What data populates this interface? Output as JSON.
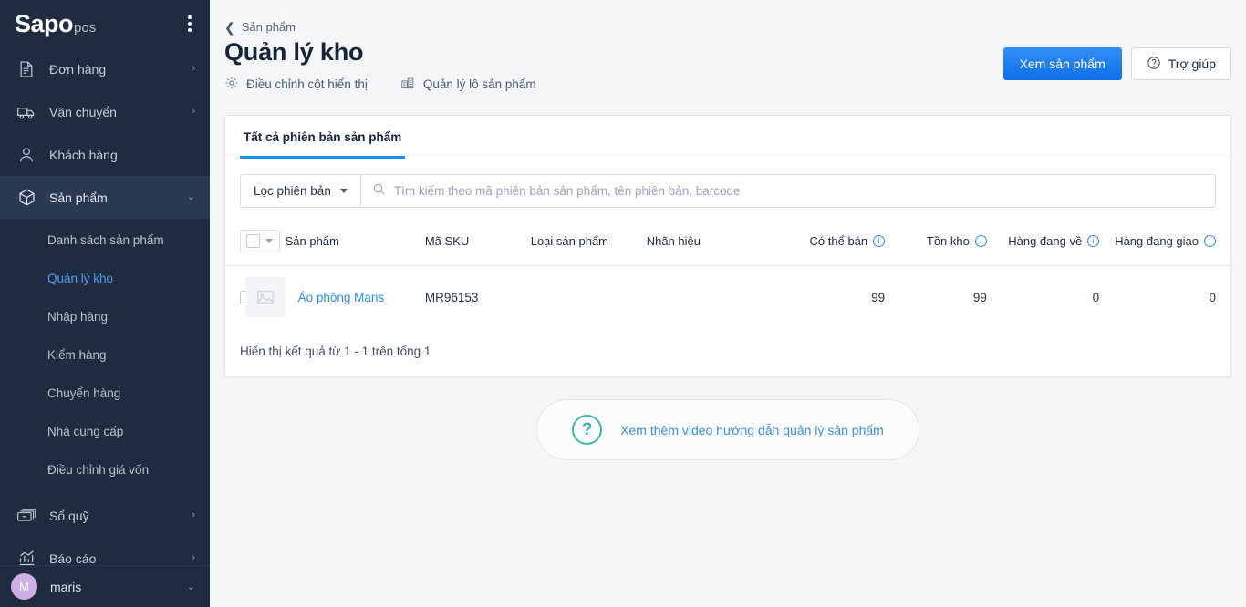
{
  "sidebar": {
    "logo": {
      "main": "Sapo",
      "sub": "pos"
    },
    "kebab_icon": "vertical-dots-icon",
    "items": [
      {
        "label": "Đơn hàng",
        "icon": "invoice-icon",
        "chevron": "›",
        "active": false
      },
      {
        "label": "Vận chuyển",
        "icon": "truck-icon",
        "chevron": "›",
        "active": false
      },
      {
        "label": "Khách hàng",
        "icon": "user-icon",
        "chevron": "",
        "active": false
      },
      {
        "label": "Sản phẩm",
        "icon": "box-icon",
        "chevron": "⌄",
        "active": true
      },
      {
        "label": "Sổ quỹ",
        "icon": "cash-icon",
        "chevron": "›",
        "active": false
      },
      {
        "label": "Báo cáo",
        "icon": "chart-icon",
        "chevron": "›",
        "active": false
      }
    ],
    "sub_items": [
      {
        "label": "Danh sách sản phẩm",
        "active": false
      },
      {
        "label": "Quản lý kho",
        "active": true
      },
      {
        "label": "Nhập hàng",
        "active": false
      },
      {
        "label": "Kiểm hàng",
        "active": false
      },
      {
        "label": "Chuyển hàng",
        "active": false
      },
      {
        "label": "Nhà cung cấp",
        "active": false
      },
      {
        "label": "Điều chỉnh giá vốn",
        "active": false
      }
    ],
    "user": {
      "initial": "M",
      "name": "maris",
      "chevron": "⌄"
    }
  },
  "header": {
    "breadcrumb": "Sản phẩm",
    "breadcrumb_icon": "chevron-left-icon",
    "title": "Quản lý kho",
    "primary_button": "Xem sản phẩm",
    "help_button": "Trợ giúp",
    "help_icon": "question-circle-icon",
    "quick_links": [
      {
        "label": "Điều chỉnh cột hiển thị",
        "icon": "gear-icon"
      },
      {
        "label": "Quản lý lô sản phẩm",
        "icon": "warehouse-icon"
      }
    ]
  },
  "card": {
    "tabs": [
      {
        "label": "Tất cả phiên bản sản phẩm",
        "active": true
      }
    ],
    "filter_button": "Lọc phiên bản",
    "search": {
      "placeholder": "Tìm kiếm theo mã phiên bản sản phẩm, tên phiên bản, barcode",
      "value": "",
      "icon": "search-icon"
    },
    "table": {
      "columns": [
        {
          "key": "check",
          "label": "",
          "align": "left"
        },
        {
          "key": "product",
          "label": "Sản phẩm",
          "align": "left"
        },
        {
          "key": "sku",
          "label": "Mã SKU",
          "align": "left"
        },
        {
          "key": "type",
          "label": "Loại sản phẩm",
          "align": "left"
        },
        {
          "key": "brand",
          "label": "Nhãn hiệu",
          "align": "left"
        },
        {
          "key": "sellable",
          "label": "Có thể bán",
          "align": "right",
          "info": true
        },
        {
          "key": "onhand",
          "label": "Tồn kho",
          "align": "right",
          "info": true
        },
        {
          "key": "incoming",
          "label": "Hàng đang về",
          "align": "right",
          "info": true
        },
        {
          "key": "shipping",
          "label": "Hàng đang giao",
          "align": "right",
          "info": true
        }
      ],
      "rows": [
        {
          "product": "Áo phông Maris",
          "sku": "MR96153",
          "type": "",
          "brand": "",
          "sellable": "99",
          "onhand": "99",
          "incoming": "0",
          "shipping": "0",
          "thumb_icon": "image-placeholder-icon"
        }
      ]
    },
    "result_note": "Hiển thị kết quả từ 1 - 1 trên tổng 1"
  },
  "video_banner": {
    "icon": "question-circle-icon",
    "label": "Xem thêm video hướng dẫn quản lý sản phẩm"
  },
  "colors": {
    "sidebar_bg": "#1f2b3e",
    "sidebar_active": "#2a3851",
    "accent_blue": "#2b8cf0",
    "primary_button": "#1a7ef0",
    "link_blue": "#4d9cf5",
    "teal": "#3bb9b0",
    "page_bg": "#f4f6f8",
    "avatar_bg": "#cdaee5"
  }
}
